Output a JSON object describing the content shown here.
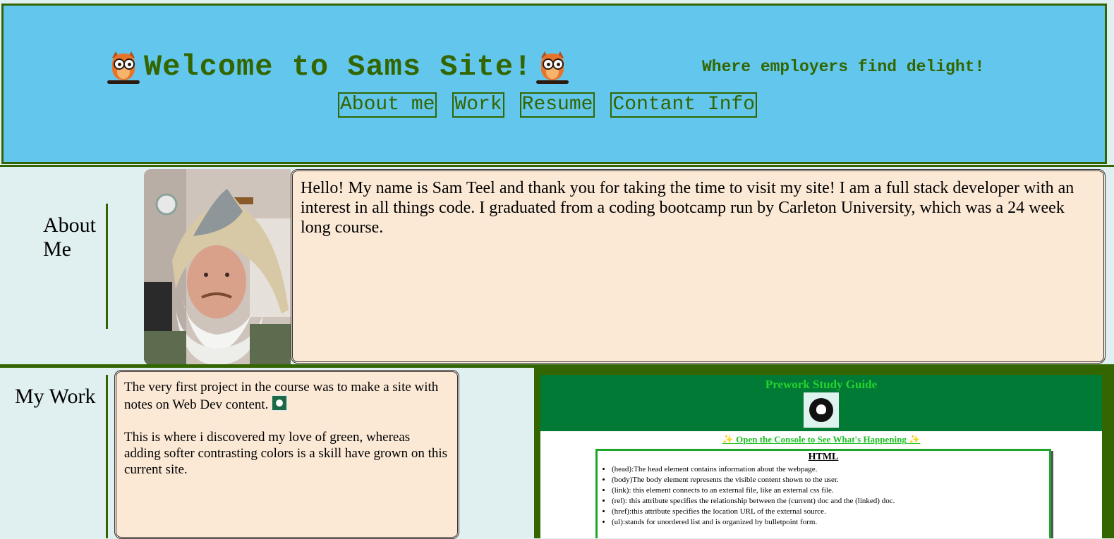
{
  "header": {
    "title": "Welcome to Sams Site!",
    "tagline": "Where employers find delight!",
    "nav": [
      "About me",
      "Work",
      "Resume",
      "Contant Info"
    ]
  },
  "about": {
    "heading_line1": "About",
    "heading_line2": "Me",
    "text": "Hello! My name is Sam Teel and thank you for taking the time to visit my site! I am a full stack developer with an interest in all things code. I graduated from a coding bootcamp run by Carleton University, which was a 24 week long course."
  },
  "work": {
    "heading": "My Work",
    "paragraph1": "The very first project in the course was to make a site with notes on Web Dev content.",
    "paragraph2": "This is where i discovered my love of green, whereas adding softer contrasting colors is a skill have grown on this current site.",
    "preview": {
      "title": "Prework Study Guide",
      "link_text": "Open the Console to See What's Happening",
      "card_title": "HTML",
      "items": [
        "(head):The head element contains information about the webpage.",
        "(body)The body element represents the visible content shown to the user.",
        "(link): this element connects to an external file, like an external css file.",
        "(rel): this attribute specifies the relationship between the (current) doc and the (linked) doc.",
        "(href):this attribute specifies the location URL of the external source.",
        "(ul):stands for unordered list and is organized by bulletpoint form."
      ]
    }
  },
  "colors": {
    "header_bg": "#63c6ec",
    "accent_green": "#336600",
    "card_bg": "#fbe9d6",
    "page_bg": "#e0eff0"
  },
  "icons": [
    "owl-icon",
    "profile-photo",
    "project-thumbnail-icon",
    "sparkle-icon"
  ]
}
